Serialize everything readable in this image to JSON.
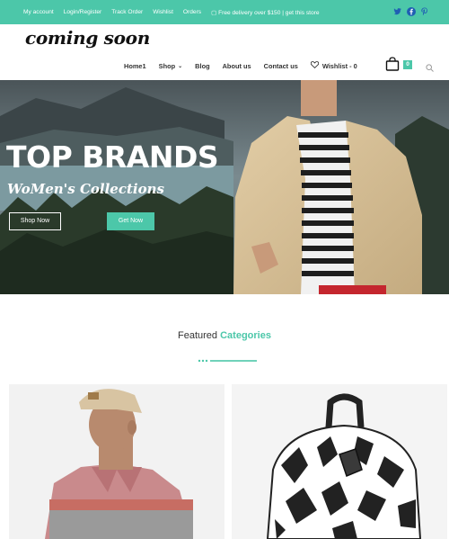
{
  "topbar": {
    "links": [
      "My account",
      "Login/Register",
      "Track Order",
      "Wishlist",
      "Orders",
      "Free delivery over $150 | get this store"
    ],
    "social": [
      "twitter-icon",
      "facebook-icon",
      "pinterest-icon"
    ],
    "background": "#4cc7a9"
  },
  "header": {
    "logo": "coming soon",
    "nav": [
      "Home1",
      "Shop",
      "Blog",
      "About us",
      "Contact us"
    ],
    "wishlist_label": "Wishlist - 0",
    "cart_count": "0"
  },
  "hero": {
    "title": "TOP BRANDS",
    "subtitle": "WoMen's Collections",
    "primary_button": "Shop Now",
    "secondary_button": "Get Now"
  },
  "featured": {
    "prefix": "Featured",
    "accent": "Categories"
  },
  "colors": {
    "accent": "#4cc7a9"
  }
}
